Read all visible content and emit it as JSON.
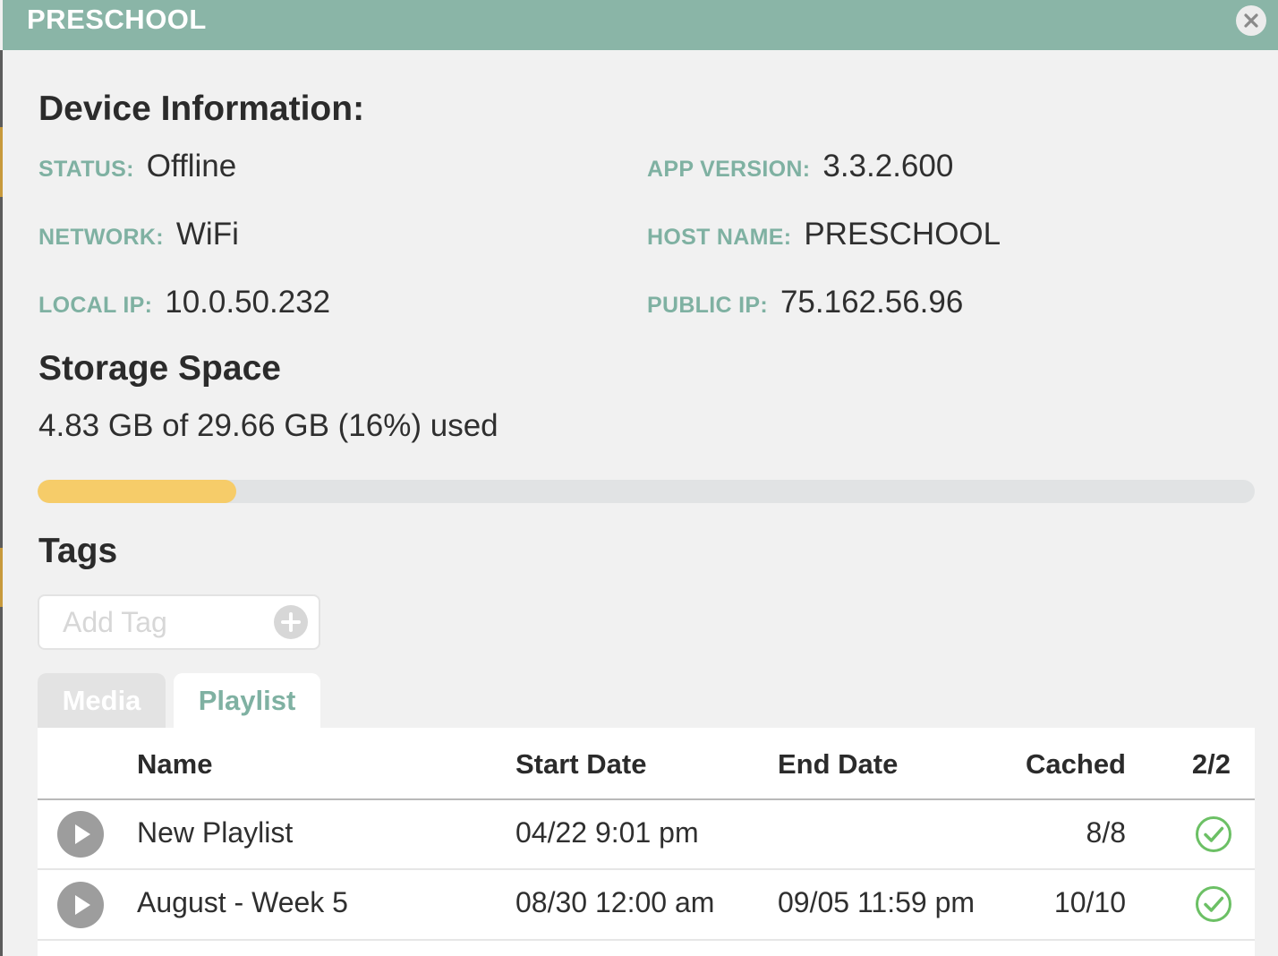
{
  "header": {
    "title": "PRESCHOOL"
  },
  "device_info": {
    "title": "Device Information:",
    "status_label": "STATUS:",
    "status_value": "Offline",
    "network_label": "NETWORK:",
    "network_value": "WiFi",
    "local_ip_label": "LOCAL IP:",
    "local_ip_value": "10.0.50.232",
    "app_version_label": "APP VERSION:",
    "app_version_value": "3.3.2.600",
    "host_name_label": "HOST NAME:",
    "host_name_value": "PRESCHOOL",
    "public_ip_label": "PUBLIC IP:",
    "public_ip_value": "75.162.56.96"
  },
  "storage": {
    "title": "Storage Space",
    "summary": "4.83 GB of 29.66 GB (16%) used",
    "used_fraction": 0.163
  },
  "tags": {
    "title": "Tags",
    "placeholder": "Add Tag"
  },
  "tabs": {
    "media_label": "Media",
    "playlist_label": "Playlist",
    "active": "Playlist"
  },
  "table": {
    "headers": {
      "name": "Name",
      "start_date": "Start Date",
      "end_date": "End Date",
      "cached": "Cached",
      "count": "2/2"
    },
    "rows": [
      {
        "name": "New Playlist",
        "start_date": "04/22 9:01 pm",
        "end_date": "",
        "cached": "8/8",
        "cached_complete": true
      },
      {
        "name": "August - Week 5",
        "start_date": "08/30 12:00 am",
        "end_date": "09/05 11:59 pm",
        "cached": "10/10",
        "cached_complete": true
      }
    ]
  },
  "colors": {
    "header_bg": "#8ab5a7",
    "label_accent": "#7fb1a2",
    "progress_fill": "#f6cc69",
    "progress_track": "#e1e3e4",
    "check_green": "#6cc065",
    "play_grey": "#9d9d9d"
  },
  "icons": {
    "close": "close-icon",
    "add_tag": "plus-icon",
    "play": "play-icon",
    "cached": "check-circle-icon"
  }
}
